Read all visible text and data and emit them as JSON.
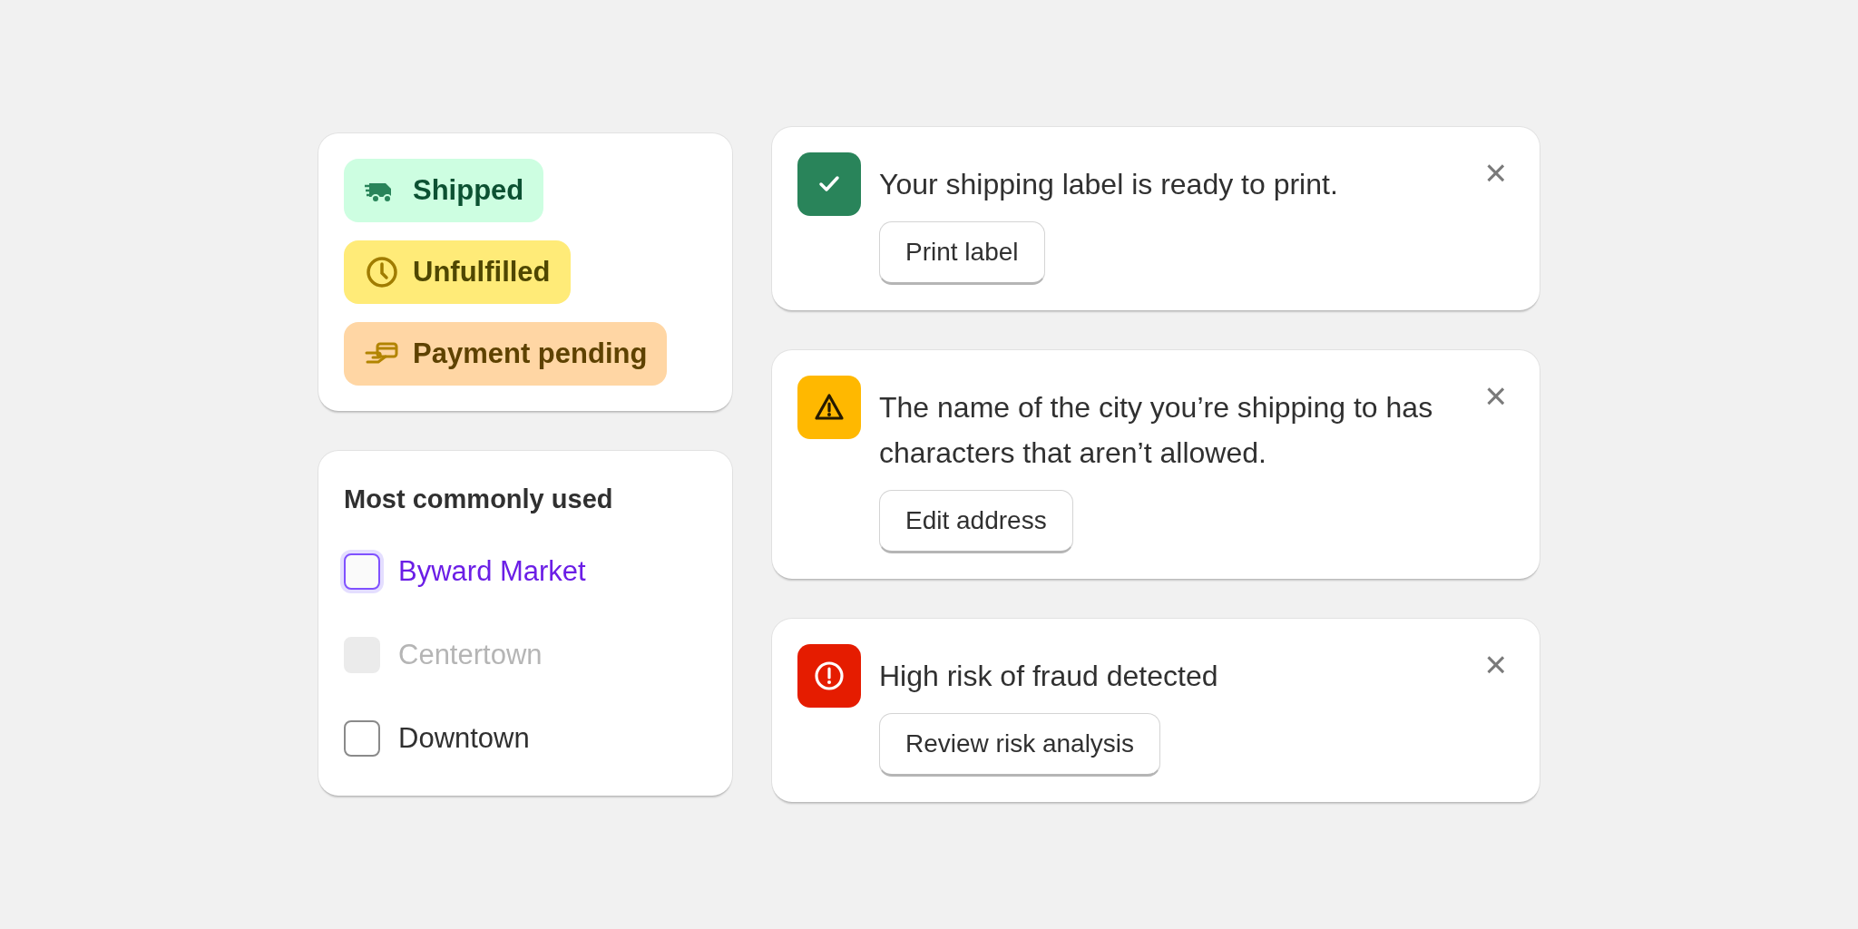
{
  "badges": [
    {
      "label": "Shipped",
      "kind": "truck"
    },
    {
      "label": "Unfulfilled",
      "kind": "clock"
    },
    {
      "label": "Payment pending",
      "kind": "payment"
    }
  ],
  "choice_list": {
    "title": "Most commonly used",
    "options": [
      {
        "label": "Byward Market",
        "checked": false,
        "focused": true,
        "disabled": false
      },
      {
        "label": "Centertown",
        "checked": false,
        "focused": false,
        "disabled": true
      },
      {
        "label": "Downtown",
        "checked": false,
        "focused": false,
        "disabled": false
      }
    ]
  },
  "banners": [
    {
      "kind": "success",
      "message": "Your shipping label is ready to print.",
      "action": "Print label",
      "close": "×"
    },
    {
      "kind": "warning",
      "message": "The name of the city you’re shipping to has characters that aren’t allowed.",
      "action": "Edit address",
      "close": "×"
    },
    {
      "kind": "critical",
      "message": "High risk of fraud detected",
      "action": "Review risk analysis",
      "close": "×"
    }
  ]
}
